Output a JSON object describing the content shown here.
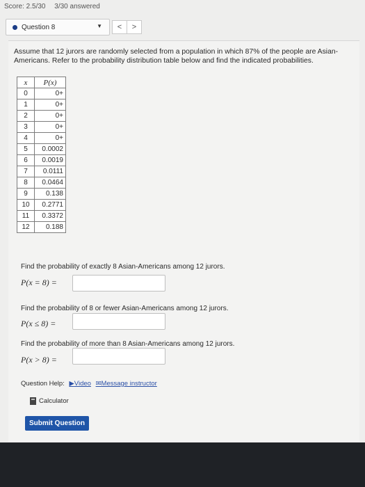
{
  "header": {
    "score": "Score: 2.5/30",
    "answered": "3/30 answered"
  },
  "question_selector": {
    "label": "Question 8",
    "prev": "<",
    "next": ">"
  },
  "problem": {
    "text": "Assume that 12 jurors are randomly selected from a population in which 87% of the people are Asian-Americans. Refer to the probability distribution table below and find the indicated probabilities."
  },
  "table": {
    "headers": [
      "x",
      "P(x)"
    ],
    "rows": [
      [
        "0",
        "0+"
      ],
      [
        "1",
        "0+"
      ],
      [
        "2",
        "0+"
      ],
      [
        "3",
        "0+"
      ],
      [
        "4",
        "0+"
      ],
      [
        "5",
        "0.0002"
      ],
      [
        "6",
        "0.0019"
      ],
      [
        "7",
        "0.0111"
      ],
      [
        "8",
        "0.0464"
      ],
      [
        "9",
        "0.138"
      ],
      [
        "10",
        "0.2771"
      ],
      [
        "11",
        "0.3372"
      ],
      [
        "12",
        "0.188"
      ]
    ]
  },
  "questions": [
    {
      "prompt": "Find the probability of exactly 8 Asian-Americans among 12 jurors.",
      "expr": "P(x = 8) =",
      "value": ""
    },
    {
      "prompt": "Find the probability of 8 or fewer Asian-Americans among 12 jurors.",
      "expr": "P(x ≤ 8) =",
      "value": ""
    },
    {
      "prompt": "Find the probability of more than 8 Asian-Americans among 12 jurors.",
      "expr": "P(x > 8) =",
      "value": ""
    }
  ],
  "help": {
    "label": "Question Help:",
    "video": "Video",
    "message": "Message instructor",
    "calculator": "Calculator"
  },
  "submit": "Submit Question",
  "colors": {
    "submit_bg": "#1f55a8",
    "link": "#2a4fa6",
    "status_dot": "#1b3c86"
  }
}
